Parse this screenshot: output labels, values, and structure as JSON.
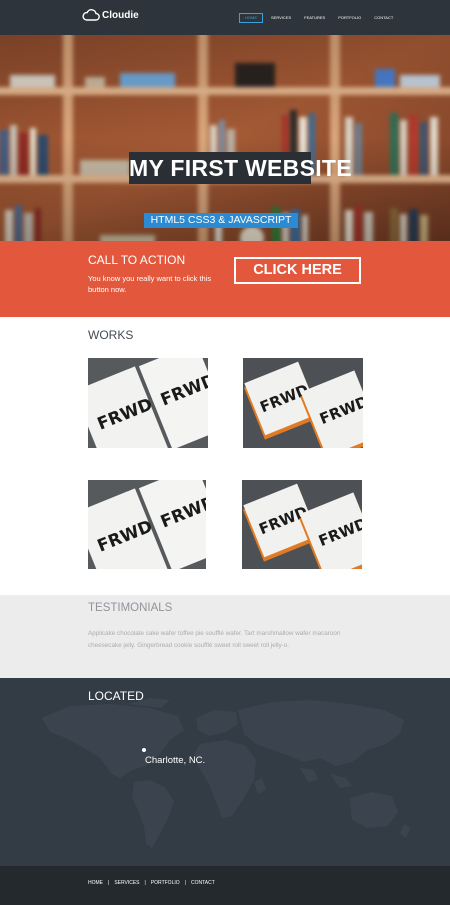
{
  "brand": {
    "name": "Cloudie",
    "logo_icon": "cloud-icon"
  },
  "nav": {
    "items": [
      {
        "label": "Home",
        "active": true
      },
      {
        "label": "Services",
        "active": false
      },
      {
        "label": "Features",
        "active": false
      },
      {
        "label": "Portfolio",
        "active": false
      },
      {
        "label": "Contact",
        "active": false
      }
    ]
  },
  "hero": {
    "title": "MY FIRST WEBSITE",
    "subtitle": "HTML5 CSS3 & JAVASCRIPT"
  },
  "cta": {
    "title": "CALL TO ACTION",
    "description": "You know you really want to click this button now.",
    "button_label": "CLICK HERE"
  },
  "works": {
    "title": "WORKS",
    "items": [
      {
        "card_text": "FRWD"
      },
      {
        "card_text": "FRWD"
      },
      {
        "card_text": "FRWD"
      },
      {
        "card_text": "FRWD"
      }
    ]
  },
  "testimonials": {
    "title": "TESTIMONIALS",
    "text": "Applicake chocolate cake wafer toffee pie soufflé wafer. Tart marshmallow wafer macaroon cheesecake jelly. Gingerbread cookie soufflé sweet roll sweet roll jelly-o."
  },
  "located": {
    "title": "LOCATED",
    "city": "Charlotte, NC."
  },
  "footer": {
    "items": [
      "Home",
      "Services",
      "Portfolio",
      "Contact"
    ]
  },
  "colors": {
    "nav_bg": "#2d343b",
    "accent_blue": "#2b8ad1",
    "cta_orange": "#e3583d",
    "testimonials_bg": "#ececec",
    "located_bg": "#333b44",
    "footer_bg": "#24292e"
  }
}
